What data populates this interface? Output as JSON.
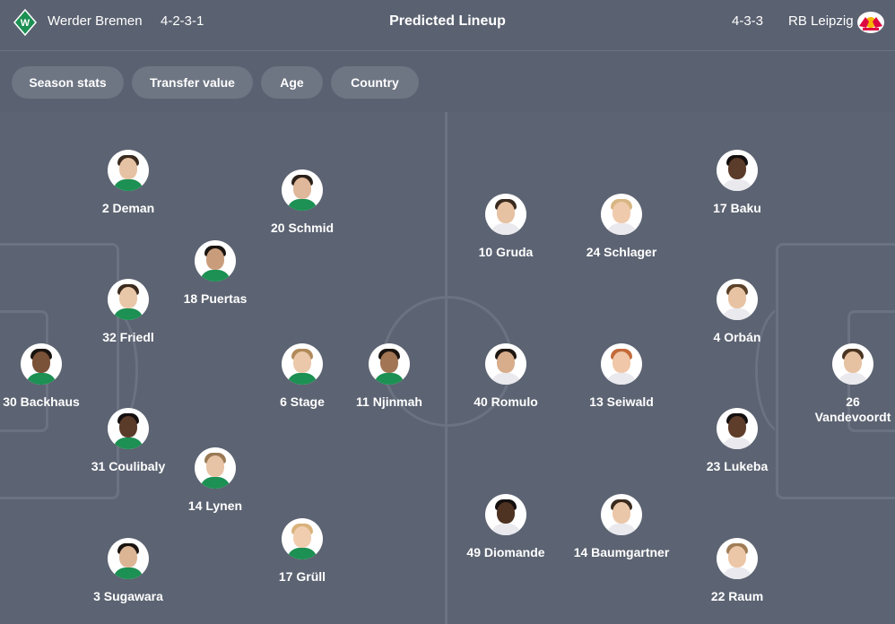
{
  "header": {
    "home_team": "Werder Bremen",
    "home_formation": "4-2-3-1",
    "title": "Predicted Lineup",
    "away_formation": "4-3-3",
    "away_team": "RB Leipzig"
  },
  "filters": [
    "Season stats",
    "Transfer value",
    "Age",
    "Country"
  ],
  "colors": {
    "background": "#5a6170",
    "chip": "#6e7583",
    "pitch_lines": "#6b7281",
    "bremen_green": "#1d9053",
    "leipzig_red": "#dd0741"
  },
  "home_players": [
    {
      "label": "2 Deman"
    },
    {
      "label": "20 Schmid"
    },
    {
      "label": "18 Puertas"
    },
    {
      "label": "32 Friedl"
    },
    {
      "label": "30 Backhaus"
    },
    {
      "label": "6 Stage"
    },
    {
      "label": "11 Njinmah"
    },
    {
      "label": "31 Coulibaly"
    },
    {
      "label": "14 Lynen"
    },
    {
      "label": "17 Grüll"
    },
    {
      "label": "3 Sugawara"
    }
  ],
  "away_players": [
    {
      "label": "17 Baku"
    },
    {
      "label": "10 Gruda"
    },
    {
      "label": "24 Schlager"
    },
    {
      "label": "4 Orbán"
    },
    {
      "label": "40 Romulo"
    },
    {
      "label": "13 Seiwald"
    },
    {
      "label": "26 Vandevoordt"
    },
    {
      "label": "23 Lukeba"
    },
    {
      "label": "49 Diomande"
    },
    {
      "label": "14 Baumgartner"
    },
    {
      "label": "22 Raum"
    }
  ]
}
